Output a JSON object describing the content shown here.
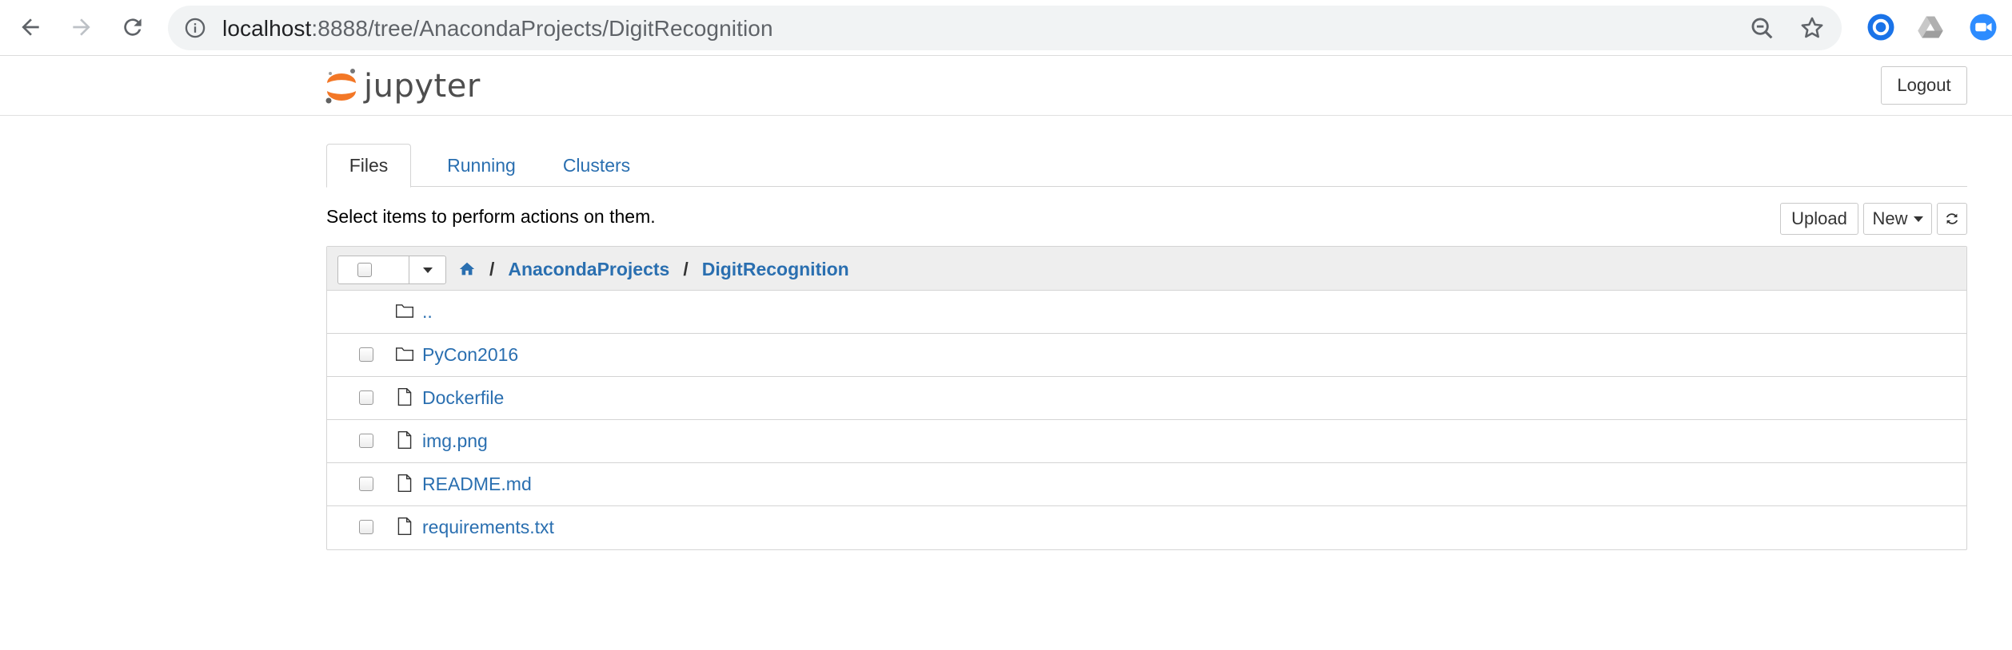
{
  "browser": {
    "url_host": "localhost",
    "url_rest": ":8888/tree/AnacondaProjects/DigitRecognition",
    "icons": [
      "back-icon",
      "forward-icon",
      "reload-icon",
      "info-icon",
      "zoom-icon",
      "star-icon",
      "extension-circle-icon",
      "google-drive-icon",
      "zoom-video-icon"
    ]
  },
  "header": {
    "logo_text": "jupyter",
    "logout_label": "Logout"
  },
  "tabs": [
    {
      "label": "Files",
      "active": true
    },
    {
      "label": "Running",
      "active": false
    },
    {
      "label": "Clusters",
      "active": false
    }
  ],
  "toolbar": {
    "instructions": "Select items to perform actions on them.",
    "upload_label": "Upload",
    "new_label": "New"
  },
  "breadcrumb": {
    "items": [
      "AnacondaProjects",
      "DigitRecognition"
    ],
    "separator": "/"
  },
  "files": [
    {
      "name": "..",
      "type": "folder",
      "checkbox": false
    },
    {
      "name": "PyCon2016",
      "type": "folder",
      "checkbox": true
    },
    {
      "name": "Dockerfile",
      "type": "file",
      "checkbox": true
    },
    {
      "name": "img.png",
      "type": "file",
      "checkbox": true
    },
    {
      "name": "README.md",
      "type": "file",
      "checkbox": true
    },
    {
      "name": "requirements.txt",
      "type": "file",
      "checkbox": true
    }
  ],
  "colors": {
    "link": "#2a6fb0",
    "jupyter_orange": "#f37726",
    "header_bg": "#eeeeee"
  }
}
